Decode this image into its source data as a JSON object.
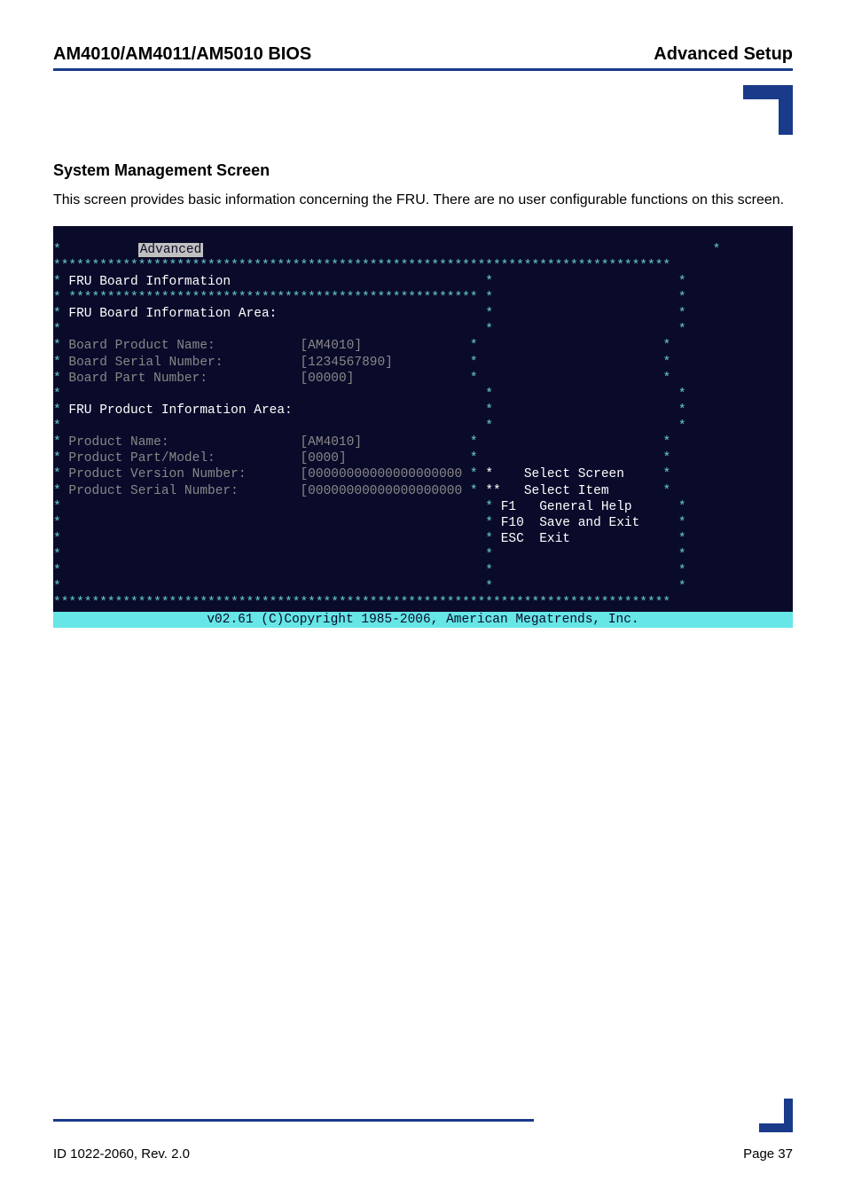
{
  "header": {
    "left": "AM4010/AM4011/AM5010 BIOS",
    "right": "Advanced Setup"
  },
  "section": {
    "heading": "System Management Screen",
    "body": "This screen provides basic information concerning the FRU. There are no user configurable functions on this screen."
  },
  "bios": {
    "tab": "Advanced",
    "star_border": "********************************************************************************",
    "title": "FRU Board Information",
    "sub_border": "*****************************************************",
    "board_area_label": "FRU Board Information Area:",
    "board": {
      "product_name_label": "Board Product Name:",
      "product_name_value": "[AM4010]",
      "serial_label": "Board Serial Number:",
      "serial_value": "[1234567890]",
      "part_label": "Board Part Number:",
      "part_value": "[00000]"
    },
    "product_area_label": "FRU Product Information Area:",
    "product": {
      "name_label": "Product Name:",
      "name_value": "[AM4010]",
      "part_model_label": "Product Part/Model:",
      "part_model_value": "[0000]",
      "version_label": "Product Version Number:",
      "version_value": "[00000000000000000000",
      "serial_label": "Product Serial Number:",
      "serial_value": "[00000000000000000000"
    },
    "help": {
      "select_screen_key": "*",
      "select_screen": "Select Screen",
      "select_item_key": "**",
      "select_item": "Select Item",
      "f1_key": "F1",
      "f1": "General Help",
      "f10_key": "F10",
      "f10": "Save and Exit",
      "esc_key": "ESC",
      "esc": "Exit"
    },
    "footer": "v02.61 (C)Copyright 1985-2006, American Megatrends, Inc."
  },
  "footer": {
    "left": "ID 1022-2060, Rev. 2.0",
    "right": "Page 37"
  }
}
